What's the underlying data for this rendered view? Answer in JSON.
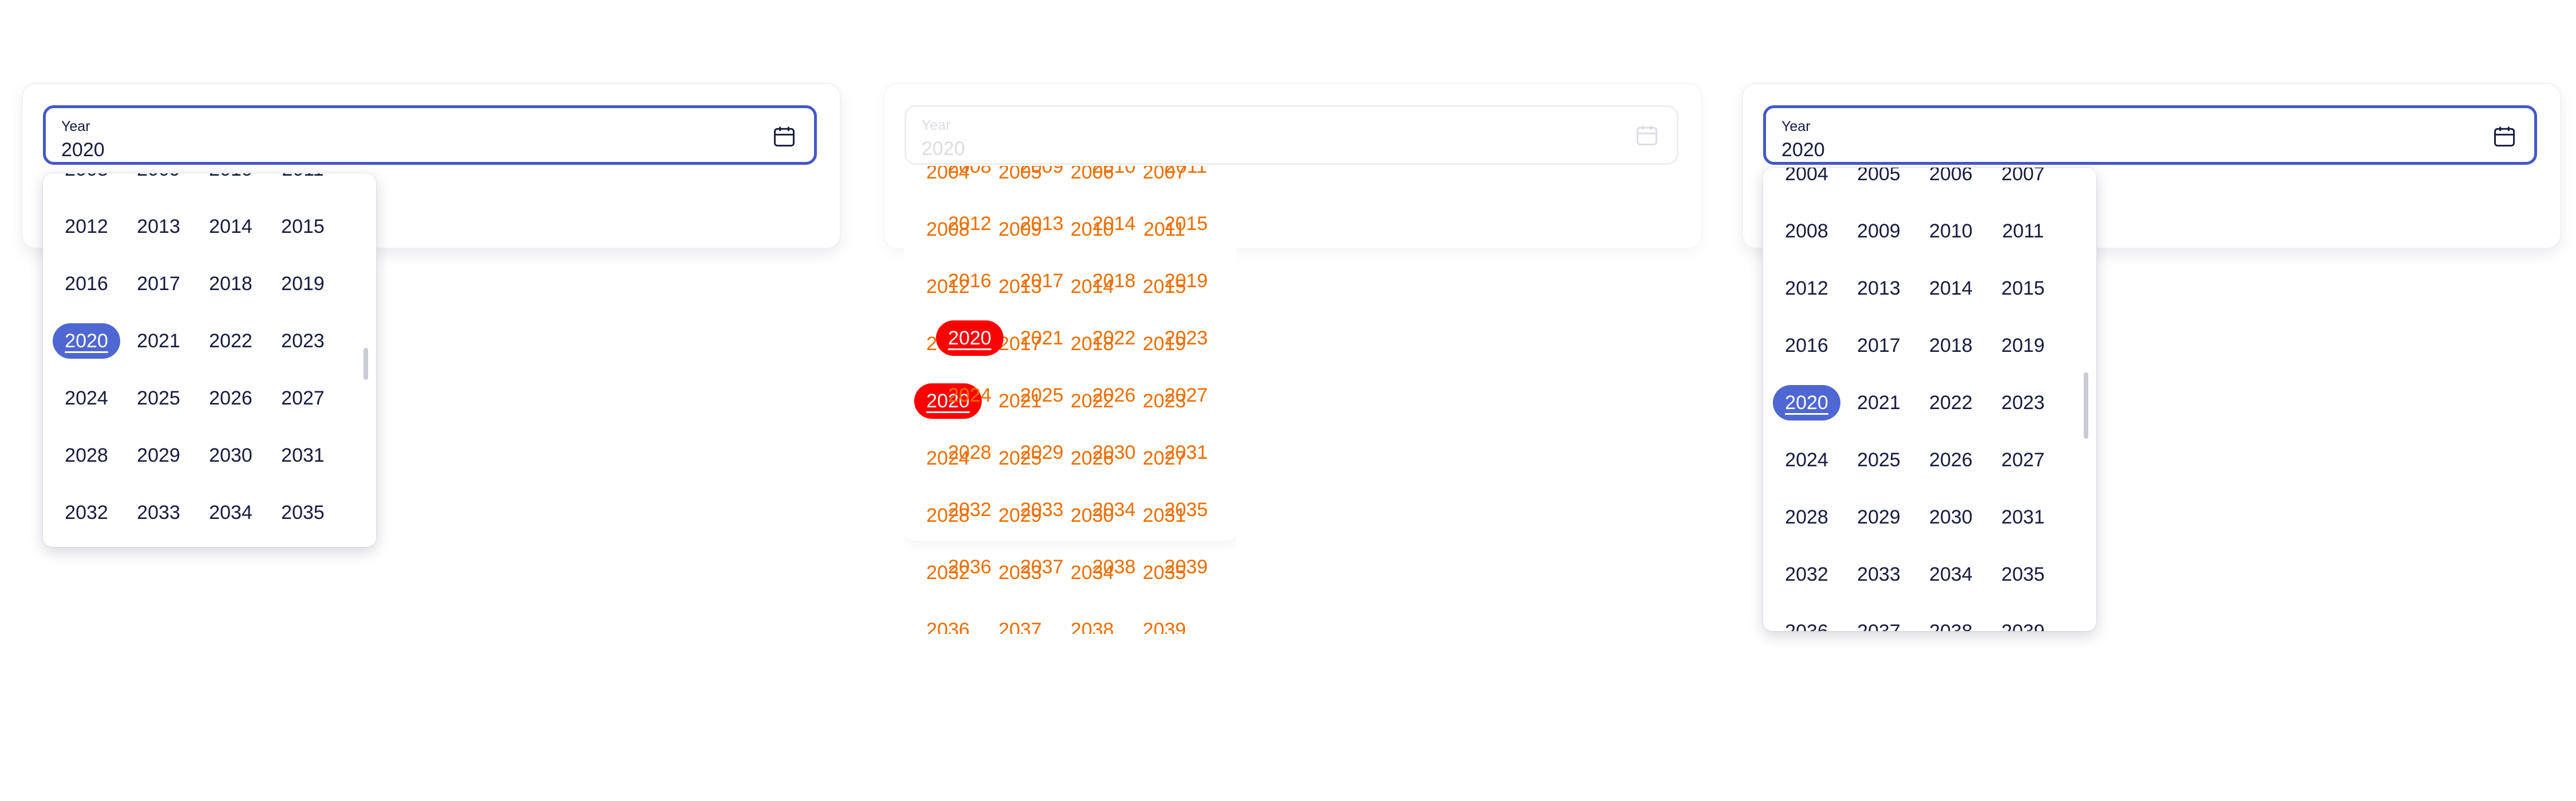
{
  "pickers": [
    {
      "id": "left",
      "label": "Year",
      "value": "2020"
    },
    {
      "id": "middle",
      "label": "Year",
      "value": "2020"
    },
    {
      "id": "right",
      "label": "Year",
      "value": "2020"
    }
  ],
  "selected_year": "2020",
  "icon": "calendar-icon",
  "accent_color": "#4e67d2",
  "border_color": "#4558c8",
  "debug_color": "#ef6c00",
  "years": [
    "2004",
    "2005",
    "2006",
    "2007",
    "2008",
    "2009",
    "2010",
    "2011",
    "2012",
    "2013",
    "2014",
    "2015",
    "2016",
    "2017",
    "2018",
    "2019",
    "2020",
    "2021",
    "2022",
    "2023",
    "2024",
    "2025",
    "2026",
    "2027",
    "2028",
    "2029",
    "2030",
    "2031",
    "2032",
    "2033",
    "2034",
    "2035",
    "2036",
    "2037",
    "2038",
    "2039"
  ]
}
